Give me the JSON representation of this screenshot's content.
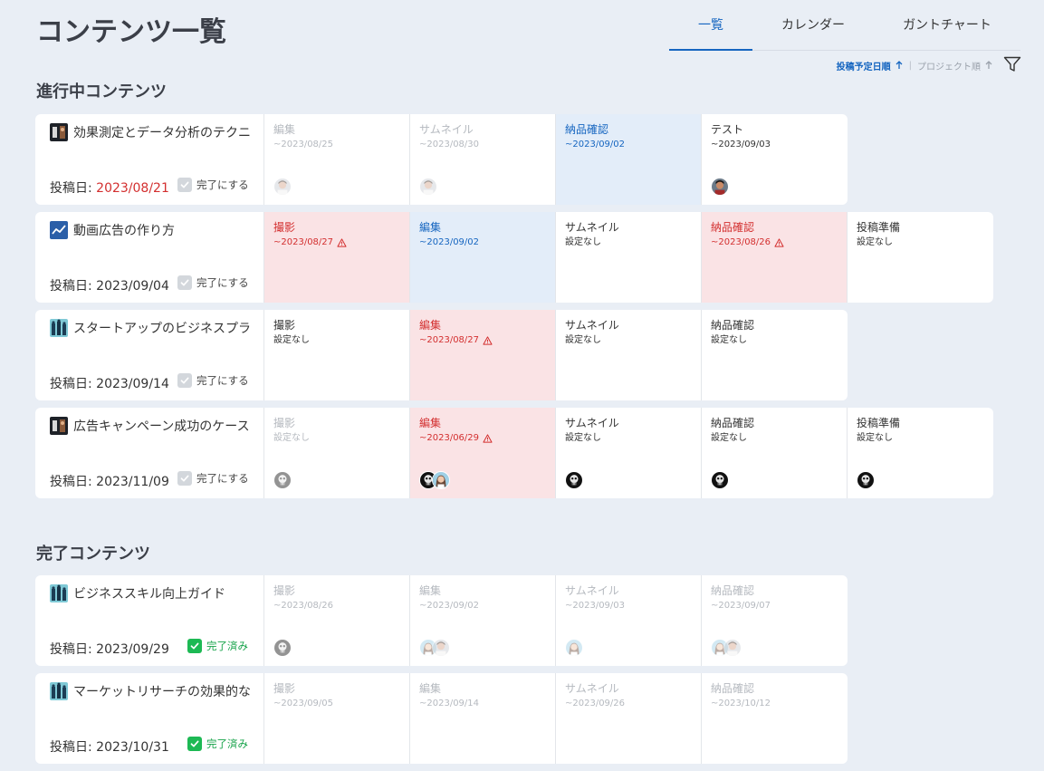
{
  "page": {
    "title": "コンテンツ一覧"
  },
  "tabs": [
    {
      "label": "一覧",
      "active": true
    },
    {
      "label": "カレンダー",
      "active": false
    },
    {
      "label": "ガントチャート",
      "active": false
    }
  ],
  "sort": {
    "primary": {
      "label": "投稿予定日順",
      "active": true
    },
    "secondary": {
      "label": "プロジェクト順",
      "active": false
    },
    "separator": "|"
  },
  "colors": {
    "accent": "#1565c0",
    "danger": "#d32f2f",
    "success": "#1db954",
    "in_progress_bg": "#e3edf9",
    "overdue_bg": "#fae3e5"
  },
  "sections": [
    {
      "title": "進行中コンテンツ",
      "rows": [
        {
          "title": "効果測定とデータ分析のテクニ",
          "icon": "dark-photo-icon",
          "date_label": "投稿日:",
          "date": "2023/08/21",
          "date_overdue": true,
          "complete_label": "完了にする",
          "completed": false,
          "steps": [
            {
              "name": "編集",
              "date": "~2023/08/25",
              "state": "dim",
              "avatars": [
                "man-a"
              ],
              "warn": false
            },
            {
              "name": "サムネイル",
              "date": "~2023/08/30",
              "state": "dim",
              "avatars": [
                "man-a"
              ],
              "warn": false
            },
            {
              "name": "納品確認",
              "date": "~2023/09/02",
              "state": "blue",
              "avatars": [],
              "warn": false
            },
            {
              "name": "テスト",
              "date": "~2023/09/03",
              "state": "normal",
              "avatars": [
                "man-b"
              ],
              "warn": false
            }
          ]
        },
        {
          "title": "動画広告の作り方",
          "icon": "chart-line-icon",
          "date_label": "投稿日:",
          "date": "2023/09/04",
          "date_overdue": false,
          "complete_label": "完了にする",
          "completed": false,
          "steps": [
            {
              "name": "撮影",
              "date": "~2023/08/27",
              "state": "red",
              "avatars": [],
              "warn": true
            },
            {
              "name": "編集",
              "date": "~2023/09/02",
              "state": "blue",
              "avatars": [],
              "warn": false
            },
            {
              "name": "サムネイル",
              "date": "設定なし",
              "state": "normal",
              "avatars": [],
              "warn": false
            },
            {
              "name": "納品確認",
              "date": "~2023/08/26",
              "state": "red",
              "avatars": [],
              "warn": true
            },
            {
              "name": "投稿準備",
              "date": "設定なし",
              "state": "normal",
              "avatars": [],
              "warn": false
            }
          ]
        },
        {
          "title": "スタートアップのビジネスプラ",
          "icon": "people-icon",
          "date_label": "投稿日:",
          "date": "2023/09/14",
          "date_overdue": false,
          "complete_label": "完了にする",
          "completed": false,
          "steps": [
            {
              "name": "撮影",
              "date": "設定なし",
              "state": "normal",
              "avatars": [],
              "warn": false
            },
            {
              "name": "編集",
              "date": "~2023/08/27",
              "state": "red",
              "avatars": [],
              "warn": true
            },
            {
              "name": "サムネイル",
              "date": "設定なし",
              "state": "normal",
              "avatars": [],
              "warn": false
            },
            {
              "name": "納品確認",
              "date": "設定なし",
              "state": "normal",
              "avatars": [],
              "warn": false
            }
          ]
        },
        {
          "title": "広告キャンペーン成功のケース",
          "icon": "dark-photo-icon",
          "date_label": "投稿日:",
          "date": "2023/11/09",
          "date_overdue": false,
          "complete_label": "完了にする",
          "completed": false,
          "steps": [
            {
              "name": "撮影",
              "date": "設定なし",
              "state": "dim",
              "avatars": [
                "skull"
              ],
              "warn": false
            },
            {
              "name": "編集",
              "date": "~2023/06/29",
              "state": "red",
              "avatars": [
                "skull",
                "woman"
              ],
              "warn": true
            },
            {
              "name": "サムネイル",
              "date": "設定なし",
              "state": "normal",
              "avatars": [
                "skull"
              ],
              "warn": false
            },
            {
              "name": "納品確認",
              "date": "設定なし",
              "state": "normal",
              "avatars": [
                "skull"
              ],
              "warn": false
            },
            {
              "name": "投稿準備",
              "date": "設定なし",
              "state": "normal",
              "avatars": [
                "skull"
              ],
              "warn": false
            }
          ]
        }
      ]
    },
    {
      "title": "完了コンテンツ",
      "rows": [
        {
          "title": "ビジネススキル向上ガイド",
          "icon": "people-icon",
          "date_label": "投稿日:",
          "date": "2023/09/29",
          "date_overdue": false,
          "complete_label": "完了済み",
          "completed": true,
          "steps": [
            {
              "name": "撮影",
              "date": "~2023/08/26",
              "state": "dim",
              "avatars": [
                "skull"
              ],
              "warn": false
            },
            {
              "name": "編集",
              "date": "~2023/09/02",
              "state": "dim",
              "avatars": [
                "woman",
                "man-a"
              ],
              "warn": false
            },
            {
              "name": "サムネイル",
              "date": "~2023/09/03",
              "state": "dim",
              "avatars": [
                "woman"
              ],
              "warn": false
            },
            {
              "name": "納品確認",
              "date": "~2023/09/07",
              "state": "dim",
              "avatars": [
                "woman",
                "man-a"
              ],
              "warn": false
            }
          ]
        },
        {
          "title": "マーケットリサーチの効果的な",
          "icon": "people-icon",
          "date_label": "投稿日:",
          "date": "2023/10/31",
          "date_overdue": false,
          "complete_label": "完了済み",
          "completed": true,
          "steps": [
            {
              "name": "撮影",
              "date": "~2023/09/05",
              "state": "dim",
              "avatars": [],
              "warn": false
            },
            {
              "name": "編集",
              "date": "~2023/09/14",
              "state": "dim",
              "avatars": [],
              "warn": false
            },
            {
              "name": "サムネイル",
              "date": "~2023/09/26",
              "state": "dim",
              "avatars": [],
              "warn": false
            },
            {
              "name": "納品確認",
              "date": "~2023/10/12",
              "state": "dim",
              "avatars": [],
              "warn": false
            }
          ]
        }
      ]
    }
  ]
}
